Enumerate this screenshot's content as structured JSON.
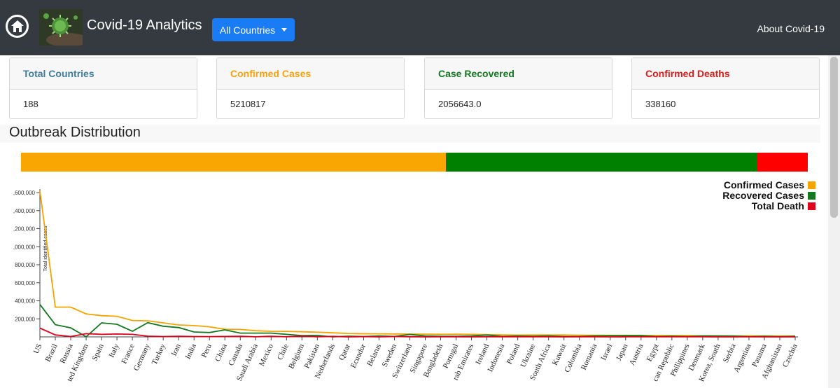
{
  "header": {
    "app_title": "Covid-19 Analytics",
    "country_select": "All Countries",
    "about_link": "About Covid-19"
  },
  "cards": [
    {
      "title": "Total Countries",
      "value": "188",
      "color": "#3e7ca1"
    },
    {
      "title": "Confirmed Cases",
      "value": "5210817",
      "color": "#f4a211"
    },
    {
      "title": "Case Recovered",
      "value": "2056643.0",
      "color": "#13781f"
    },
    {
      "title": "Confirmed Deaths",
      "value": "338160",
      "color": "#dd1c1c"
    }
  ],
  "distribution": {
    "title": "Outbreak Distribution",
    "segments": [
      {
        "name": "Confirmed Cases",
        "fraction": 0.54,
        "color": "#f9a602"
      },
      {
        "name": "Recovered Cases",
        "fraction": 0.395,
        "color": "#008000"
      },
      {
        "name": "Total Death",
        "fraction": 0.065,
        "color": "#ff0000"
      }
    ]
  },
  "chart_data": {
    "type": "line",
    "ylabel": "Total identified cases",
    "ylim": [
      0,
      1600000
    ],
    "yticks": [
      200000,
      400000,
      600000,
      800000,
      1000000,
      1200000,
      1400000,
      1600000
    ],
    "ytick_labels": [
      ",200,000",
      ",400,000",
      ",600,000",
      ",800,000",
      ",000,000",
      ",200,000",
      ",400,000",
      ",600,000"
    ],
    "ytick_labels_short": [
      "200,000",
      "400,000",
      "600,000",
      "800,000"
    ],
    "categories": [
      "US",
      "Brazil",
      "Russia",
      "ted Kingdom",
      "Spain",
      "Italy",
      "France",
      "Germany",
      "Turkey",
      "Iran",
      "India",
      "Peru",
      "China",
      "Canada",
      "Saudi Arabia",
      "Mexico",
      "Chile",
      "Belgium",
      "Pakistan",
      "Netherlands",
      "Qatar",
      "Ecuador",
      "Belarus",
      "Sweden",
      "Switzerland",
      "Singapore",
      "Bangladesh",
      "Portugal",
      "rab Emirates",
      "Ireland",
      "Indonesia",
      "Poland",
      "Ukraine",
      "South Africa",
      "Kuwait",
      "Colombia",
      "Romania",
      "Israel",
      "Japan",
      "Austria",
      "Egypt",
      "can Republic",
      "Philippines",
      "Denmark",
      "Korea, South",
      "Serbia",
      "Argentina",
      "Panama",
      "Afghanistan",
      "Czechia"
    ],
    "series": [
      {
        "name": "Confirmed Cases",
        "color": "#f4a300",
        "values": [
          1620000,
          330000,
          330000,
          255000,
          235000,
          228000,
          182000,
          178000,
          155000,
          132000,
          125000,
          112000,
          84000,
          82000,
          68000,
          62000,
          61000,
          57000,
          52000,
          45000,
          38000,
          35000,
          34000,
          33000,
          31000,
          30000,
          29000,
          30000,
          28000,
          25000,
          22000,
          20000,
          21000,
          21000,
          21000,
          19000,
          18000,
          17000,
          17000,
          16000,
          15000,
          15000,
          14000,
          12000,
          11000,
          11000,
          10000,
          10000,
          9000,
          9000
        ]
      },
      {
        "name": "Recovered Cases",
        "color": "#13781f",
        "values": [
          360000,
          135000,
          100000,
          1000,
          155000,
          140000,
          62000,
          158000,
          118000,
          103000,
          54000,
          48000,
          78000,
          42000,
          42000,
          42000,
          28000,
          15000,
          16000,
          300,
          8000,
          4000,
          11000,
          5000,
          27000,
          10000,
          6000,
          7000,
          11000,
          21000,
          5000,
          9000,
          6000,
          10000,
          4000,
          4000,
          10000,
          13000,
          14000,
          14000,
          4000,
          8000,
          4000,
          10000,
          10000,
          9000,
          3000,
          6000,
          2000,
          6000
        ]
      },
      {
        "name": "Total Death",
        "color": "#e0001b",
        "values": [
          97000,
          22000,
          3500,
          36000,
          28000,
          32000,
          28000,
          8000,
          4200,
          7300,
          3700,
          3200,
          4600,
          6400,
          400,
          7000,
          700,
          9200,
          1100,
          5800,
          20,
          3100,
          200,
          3900,
          1900,
          20,
          400,
          1300,
          250,
          1600,
          1400,
          1000,
          600,
          400,
          170,
          700,
          1200,
          280,
          820,
          640,
          800,
          400,
          880,
          560,
          270,
          240,
          500,
          300,
          200,
          310
        ]
      }
    ],
    "legend": [
      "Confirmed Cases",
      "Recovered Cases",
      "Total Death"
    ],
    "legend_position": "top-right"
  }
}
